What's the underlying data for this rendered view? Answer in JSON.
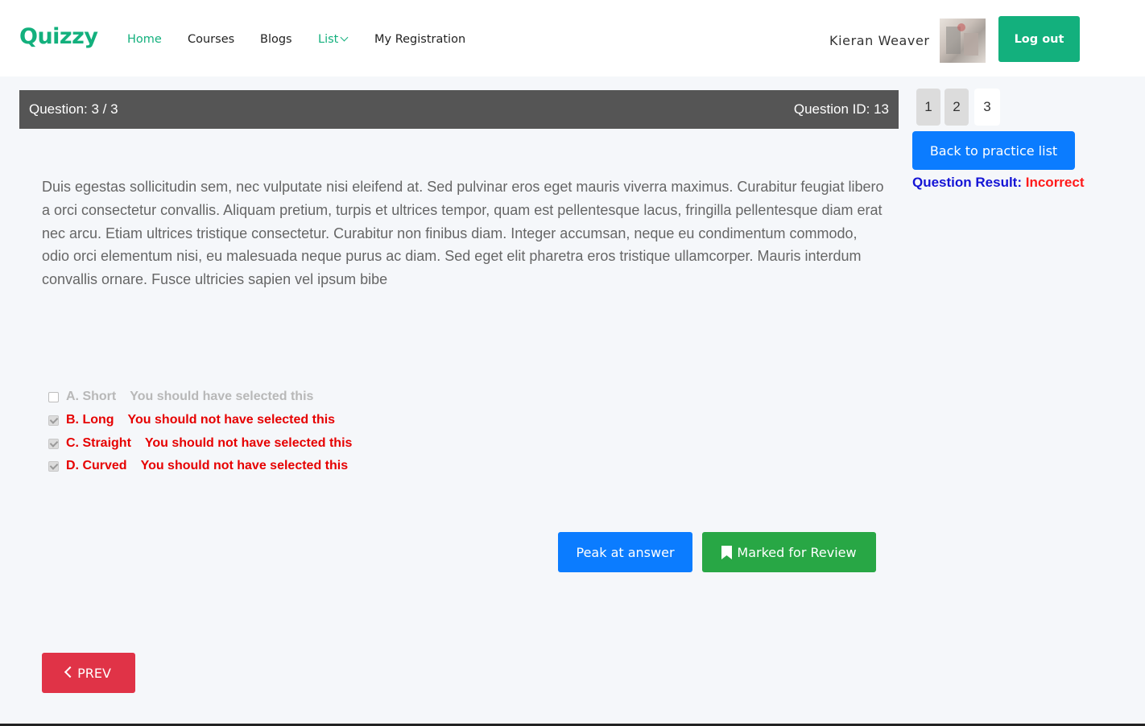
{
  "header": {
    "logo": "Quizzy",
    "nav": [
      {
        "label": "Home",
        "active": true
      },
      {
        "label": "Courses",
        "active": false
      },
      {
        "label": "Blogs",
        "active": false
      },
      {
        "label": "List",
        "active": true,
        "dropdown": true
      },
      {
        "label": "My Registration",
        "active": false
      }
    ],
    "user_name": "Kieran Weaver",
    "logout_label": "Log out"
  },
  "question_bar": {
    "number_text": "Question: 3 / 3",
    "id_text": "Question ID: 13"
  },
  "pagination": {
    "pages": [
      "1",
      "2",
      "3"
    ],
    "current": "3"
  },
  "sidebar": {
    "back_label": "Back to practice list",
    "result_label": "Question Result:",
    "result_value": "Incorrect"
  },
  "question": {
    "text": "Duis egestas sollicitudin sem, nec vulputate nisi eleifend at. Sed pulvinar eros eget mauris viverra maximus. Curabitur feugiat libero a orci consectetur convallis. Aliquam pretium, turpis et ultrices tempor, quam est pellentesque lacus, fringilla pellentesque diam erat nec arcu. Etiam ultrices tristique consectetur. Curabitur non finibus diam. Integer accumsan, neque eu condimentum commodo, odio orci elementum nisi, eu malesuada neque purus ac diam. Sed eget elit pharetra eros tristique ullamcorper. Mauris interdum convallis ornare. Fusce ultricies sapien vel ipsum bibe"
  },
  "options": [
    {
      "label": "A. Short",
      "checked": false,
      "feedback": "You should have selected this"
    },
    {
      "label": "B. Long",
      "checked": true,
      "feedback": "You should not have selected this"
    },
    {
      "label": "C. Straight",
      "checked": true,
      "feedback": "You should not have selected this"
    },
    {
      "label": "D. Curved",
      "checked": true,
      "feedback": "You should not have selected this"
    }
  ],
  "actions": {
    "peak_label": "Peak at answer",
    "review_label": "Marked for Review",
    "prev_label": "PREV"
  },
  "colors": {
    "brand": "#13b07d",
    "primary": "#0b7cff",
    "success": "#28a745",
    "danger": "#e03347",
    "incorrect": "#ff1a1a"
  }
}
